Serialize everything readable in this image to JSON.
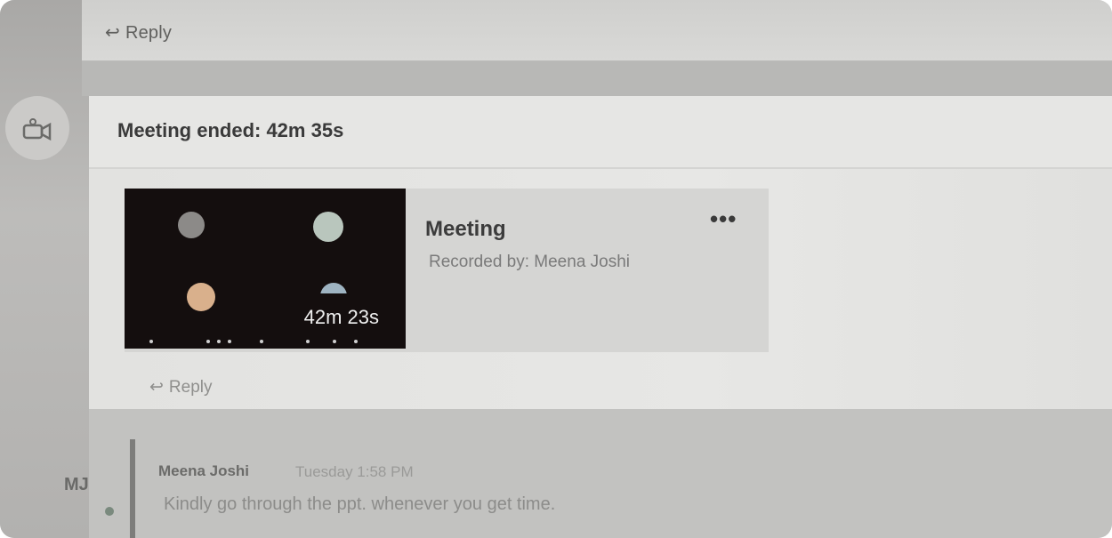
{
  "top_reply": {
    "icon": "reply-arrow-icon",
    "label": "Reply"
  },
  "meeting": {
    "status": "Meeting ended: 42m 35s",
    "recording": {
      "title": "Meeting",
      "recorded_by": "Recorded by: Meena Joshi",
      "duration": "42m 23s",
      "more": "•••"
    },
    "reply": {
      "icon": "reply-arrow-icon",
      "label": "Reply"
    }
  },
  "message": {
    "avatar_initials": "MJ",
    "author": "Meena Joshi",
    "timestamp": "Tuesday 1:58 PM",
    "text": "Kindly go through the ppt. whenever you get time."
  }
}
